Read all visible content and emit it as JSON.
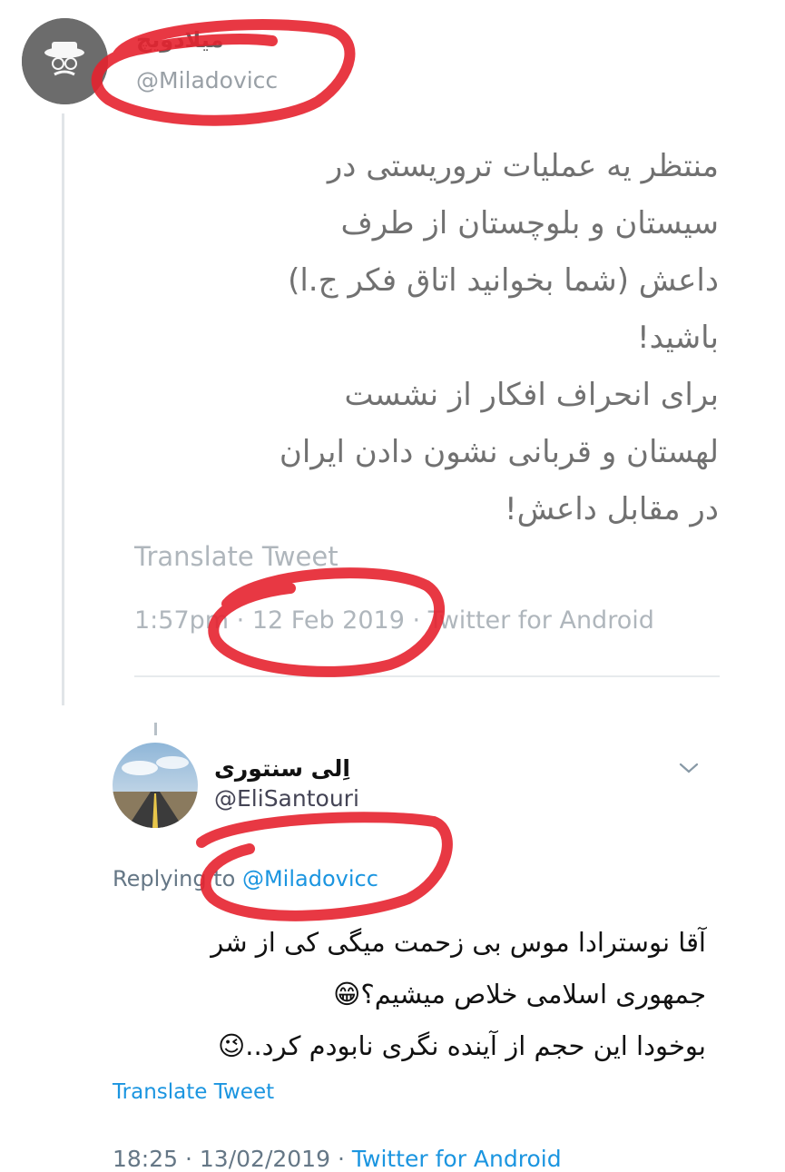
{
  "tweet1": {
    "display_name": "میلادویچ",
    "handle": "@Miladovicc",
    "body": "منتظر یه عملیات تروریستی در\nسیستان و بلوچستان از طرف\nداعش (شما بخوانید اتاق فکر ج.ا)\nباشید!\nبرای انحراف افکار از نشست\nلهستان و قربانی نشون دادن ایران\nدر مقابل داعش!",
    "translate_label": "Translate Tweet",
    "time": "1:57pm",
    "date": "12 Feb 2019",
    "source": "Twitter for Android",
    "separator": "·"
  },
  "tweet2": {
    "display_name": "اِلی سنتوری",
    "handle": "@EliSantouri",
    "replying_prefix": "Replying to",
    "replying_handle": "@Miladovicc",
    "body": "آقا نوسترادا موس بی زحمت میگی کی از شر\nجمهوری اسلامی خلاص میشیم؟😁\nبوخودا این حجم از آینده نگری نابودم کرد..😉",
    "translate_label": "Translate Tweet",
    "time": "18:25",
    "date": "13/02/2019",
    "source": "Twitter for Android",
    "separator": "·"
  },
  "icons": {
    "avatar1": "masked-figure-avatar-icon",
    "avatar2": "road-landscape-avatar-icon",
    "more": "chevron-down-icon"
  },
  "colors": {
    "link": "#1b95e0",
    "muted": "#657786",
    "annotation": "#e5222f"
  }
}
